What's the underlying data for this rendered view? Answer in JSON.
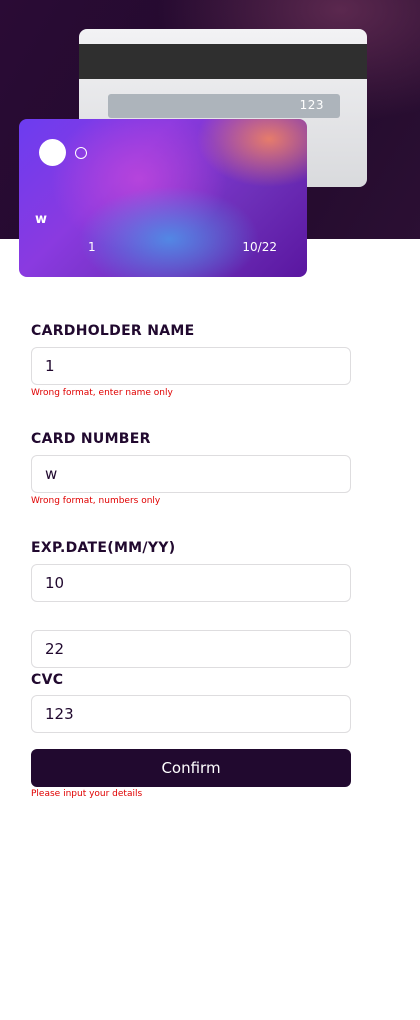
{
  "card_back": {
    "cvc": "123"
  },
  "card_front": {
    "number": "w",
    "name": "1",
    "expiry": "10/22"
  },
  "form": {
    "name_label": "CARDHOLDER NAME",
    "name_value": "1",
    "name_error": "Wrong format, enter name only",
    "number_label": "CARD NUMBER",
    "number_value": "w",
    "number_error": "Wrong format, numbers only",
    "exp_label": "EXP.DATE(MM/YY)",
    "exp_month_value": "10",
    "exp_year_value": "22",
    "cvc_label": "CVC",
    "cvc_value": "123",
    "confirm_label": "Confirm",
    "submit_error": "Please input your details"
  },
  "colors": {
    "hero_bg": "#220a2c",
    "button_bg": "#21092f",
    "error_text": "#e00000",
    "card_gradient_start": "#6c3cf0",
    "card_gradient_end": "#5a16a0"
  }
}
